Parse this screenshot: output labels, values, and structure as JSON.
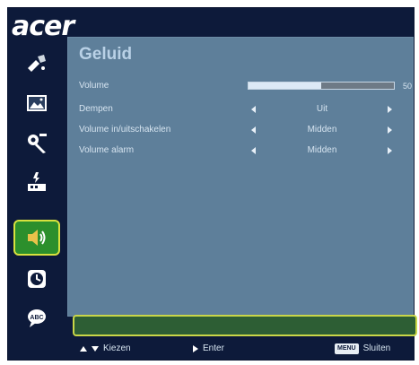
{
  "brand": {
    "logo_text": "acer"
  },
  "sidebar": {
    "items": [
      {
        "icon": "color-wand-icon"
      },
      {
        "icon": "image-icon"
      },
      {
        "icon": "settings-gear-icon"
      },
      {
        "icon": "management-icon"
      },
      {
        "icon": "audio-speaker-icon",
        "active": true
      },
      {
        "icon": "timer-clock-icon"
      },
      {
        "icon": "language-icon"
      }
    ]
  },
  "main": {
    "title": "Geluid",
    "volume": {
      "label": "Volume",
      "value_text": "50",
      "level_percent": 50
    },
    "rows": [
      {
        "label": "Dempen",
        "value": "Uit"
      },
      {
        "label": "Volume in/uitschakelen",
        "value": "Midden"
      },
      {
        "label": "Volume alarm",
        "value": "Midden"
      }
    ]
  },
  "footer": {
    "select_label": "Kiezen",
    "enter_label": "Enter",
    "menu_key": "MENU",
    "close_label": "Sluiten"
  },
  "colors": {
    "frame": "#0d1a3a",
    "panel": "#5e7f9a",
    "active_item": "#2c8f2c",
    "highlight_border": "#d8e23e"
  }
}
